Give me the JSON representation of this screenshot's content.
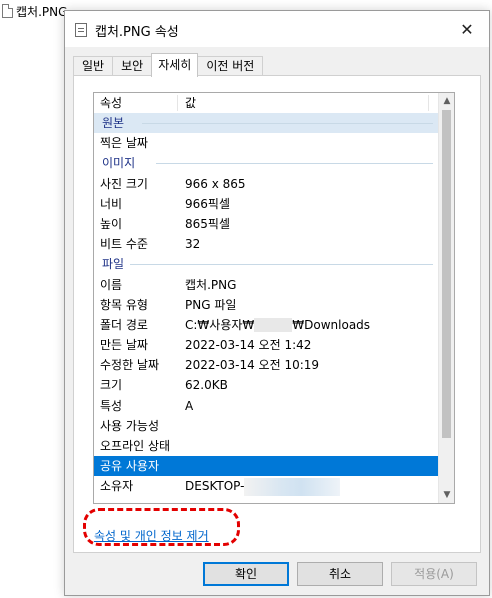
{
  "desktop": {
    "file_name": "캡처.PNG"
  },
  "dialog": {
    "title": "캡처.PNG 속성",
    "close_glyph": "✕"
  },
  "tabs": [
    {
      "label": "일반"
    },
    {
      "label": "보안"
    },
    {
      "label": "자세히"
    },
    {
      "label": "이전 버전"
    }
  ],
  "list": {
    "headers": {
      "property": "속성",
      "value": "값"
    },
    "groups": {
      "source": "원본",
      "image": "이미지",
      "file": "파일"
    },
    "rows": {
      "date_taken": {
        "label": "찍은 날짜",
        "value": ""
      },
      "dimensions": {
        "label": "사진 크기",
        "value": "966 x 865"
      },
      "width": {
        "label": "너비",
        "value": "966픽셀"
      },
      "height": {
        "label": "높이",
        "value": "865픽셀"
      },
      "bit_depth": {
        "label": "비트 수준",
        "value": "32"
      },
      "name": {
        "label": "이름",
        "value": "캡처.PNG"
      },
      "item_type": {
        "label": "항목 유형",
        "value": "PNG 파일"
      },
      "folder_path": {
        "label": "폴더 경로",
        "value_prefix": "C:₩사용자₩",
        "value_suffix": "₩Downloads"
      },
      "date_created": {
        "label": "만든 날짜",
        "value": "2022-03-14 오전 1:42"
      },
      "date_modified": {
        "label": "수정한 날짜",
        "value": "2022-03-14 오전 10:19"
      },
      "size": {
        "label": "크기",
        "value": "62.0KB"
      },
      "attributes": {
        "label": "특성",
        "value": "A"
      },
      "availability": {
        "label": "사용 가능성",
        "value": ""
      },
      "offline_status": {
        "label": "오프라인 상태",
        "value": ""
      },
      "shared_with": {
        "label": "공유 사용자",
        "value": ""
      },
      "owner": {
        "label": "소유자",
        "value_prefix": "DESKTOP-"
      }
    },
    "scroll": {
      "up_glyph": "▲",
      "down_glyph": "▼"
    }
  },
  "remove_link": "속성 및 개인 정보 제거",
  "buttons": {
    "ok": "확인",
    "cancel": "취소",
    "apply": "적용(A)"
  },
  "colors": {
    "selection": "#0078d7",
    "group_label": "#1e3287",
    "link": "#0066cc",
    "annotation": "#e30000"
  }
}
